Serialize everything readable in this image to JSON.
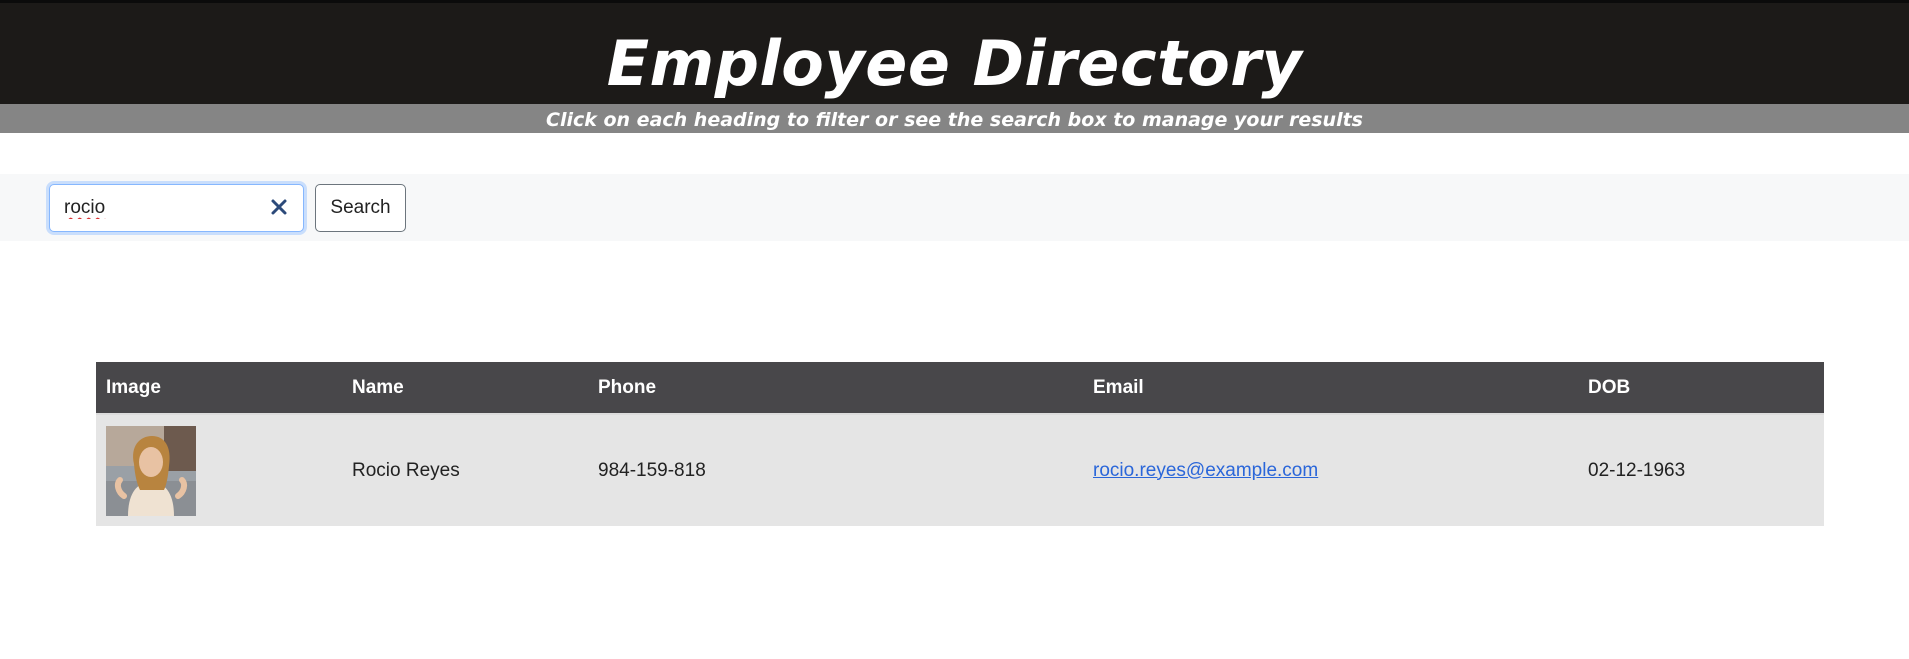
{
  "header": {
    "title": "Employee Directory",
    "subtitle": "Click on each heading to filter or see the search box to manage your results"
  },
  "search": {
    "value": "rocio",
    "placeholder": "",
    "button_label": "Search"
  },
  "table": {
    "columns": [
      "Image",
      "Name",
      "Phone",
      "Email",
      "DOB"
    ],
    "rows": [
      {
        "image": "employee-photo",
        "name": "Rocio Reyes",
        "phone": "984-159-818",
        "email": "rocio.reyes@example.com",
        "dob": "02-12-1963"
      }
    ]
  },
  "colors": {
    "banner": "#1c1a18",
    "subbar": "#858585",
    "table_header": "#48474a",
    "row": "#e5e5e5",
    "link": "#2a66d9"
  }
}
